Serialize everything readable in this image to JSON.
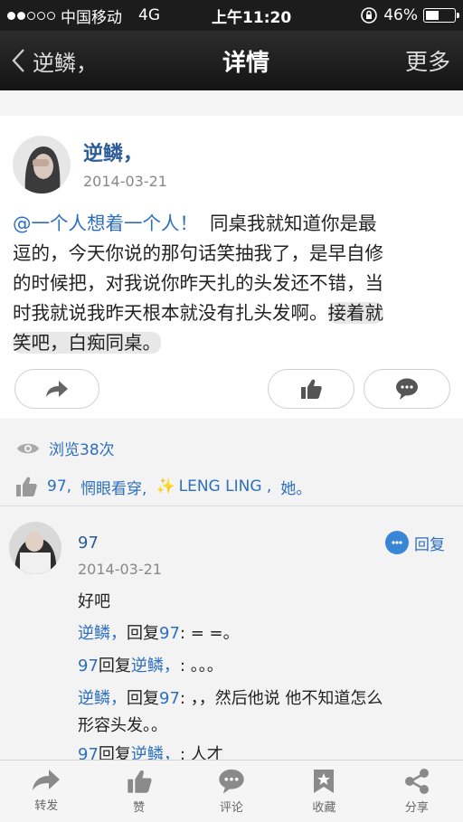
{
  "status_bar": {
    "carrier": "中国移动",
    "network": "4G",
    "time": "上午11:20",
    "battery": "46%",
    "battery_level": 0.46
  },
  "nav": {
    "back_label": "逆鳞，",
    "title": "详情",
    "more_label": "更多"
  },
  "post": {
    "author": "逆鳞，",
    "date": "2014-03-21",
    "mention": "@一个人想着一个人！",
    "lines": [
      "同桌我就知道你是最",
      "逗的，今天你说的那句话笑抽我了，是早自修",
      "的时候把，对我说你昨天扎的头发还不错，当",
      "时我就说我昨天根本就没有扎头发啊。",
      "接着就",
      "笑吧，白痴同桌。"
    ]
  },
  "stats": {
    "views": "浏览38次",
    "likes_prefix": "97,",
    "likes_names": "惘眼看穿,",
    "likes_names2": "LENG LING ,",
    "likes_suffix": "她。"
  },
  "comment": {
    "author": "97",
    "date": "2014-03-21",
    "reply_label": "回复",
    "body": "好吧",
    "replies": [
      {
        "who": "逆鳞，",
        "verb": "回复",
        "target": "97",
        "text": ": = =。"
      },
      {
        "who": "97",
        "verb": "回复",
        "target": "逆鳞，",
        "text": ": 。。。"
      },
      {
        "who": "逆鳞，",
        "verb": "回复",
        "target": "97",
        "text": ": ，，然后他说 他不知道怎么"
      },
      {
        "who": "",
        "verb": "",
        "target": "",
        "text": "形容头发。。"
      },
      {
        "who": "97",
        "verb": "回复",
        "target": "逆鳞，",
        "text": ": 人才"
      }
    ]
  },
  "toolbar": {
    "forward": "转发",
    "like": "赞",
    "comment": "评论",
    "favorite": "收藏",
    "share": "分享"
  }
}
